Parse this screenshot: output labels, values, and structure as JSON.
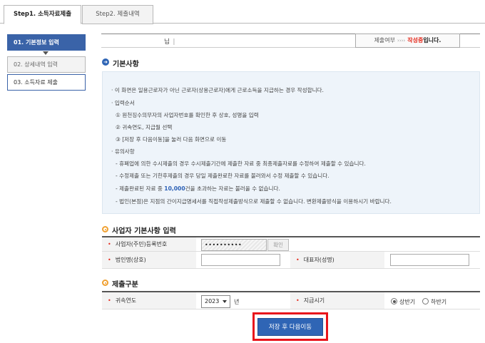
{
  "tabs": [
    {
      "label": "Step1. 소득자료제출"
    },
    {
      "label": "Step2. 제출내역"
    }
  ],
  "steps": [
    {
      "label": "01. 기본정보 입력"
    },
    {
      "label": "02. 상세내역 입력"
    },
    {
      "label": "03. 소득자료 제출"
    }
  ],
  "status": {
    "name_suffix": "님",
    "name_sep": "|",
    "label": "제출여부",
    "arrows": "››››",
    "state": "작성중",
    "tail": "입니다."
  },
  "basic": {
    "title": "기본사항",
    "lines": [
      "· 이 화면은 일용근로자가 아닌 근로자(상용근로자)에게 근로소득을 지급하는 경우 작성합니다.",
      "· 입력순서",
      "① 원천징수의무자의 사업자번호를 확인한 후 상호, 성명을 입력",
      "② 귀속연도, 지급월 선택",
      "③ [저장 후 다음이동]을 눌러 다음 화면으로 이동",
      "· 유의사항",
      "- 휴폐업에 의한 수시제출의 경우 수시제출기간에 제출한 자료 중 최종제출자료를 수정하여 제출할 수 있습니다.",
      "- 수정제출 또는 기한후제출의 경우 당일 제출완료한 자료를 불러와서 수정 제출할 수 있습니다.",
      "- 법인(본점)은 지점의 간이지급명세서를 직접작성제출방식으로 제출할 수 없습니다. 변환제출방식을 이용하시기 바랍니다."
    ],
    "limit_line": {
      "before": "- 제출완료된 자료 중 ",
      "highlight": "10,000",
      "after": "건을 초과하는 자료는 불러올 수 없습니다."
    }
  },
  "business": {
    "title": "사업자 기본사항 입력",
    "req_mark": "•",
    "reg_label": "사업자(주민)등록번호",
    "reg_value": "••••••••••",
    "confirm_label": "확인",
    "corp_label": "법인명(상호)",
    "corp_value": "",
    "rep_label": "대표자(성명)",
    "rep_value": ""
  },
  "submission": {
    "title": "제출구분",
    "year_label": "귀속연도",
    "year_value": "2023",
    "year_unit": "년",
    "pay_label": "지급시기",
    "options": [
      {
        "label": "상반기",
        "selected": true
      },
      {
        "label": "하반기",
        "selected": false
      }
    ]
  },
  "submit": {
    "label": "저장 후 다음이동"
  },
  "colors": {
    "primary": "#2f65b5",
    "highlight_border": "#e8141b",
    "state": "#e52b1e"
  }
}
